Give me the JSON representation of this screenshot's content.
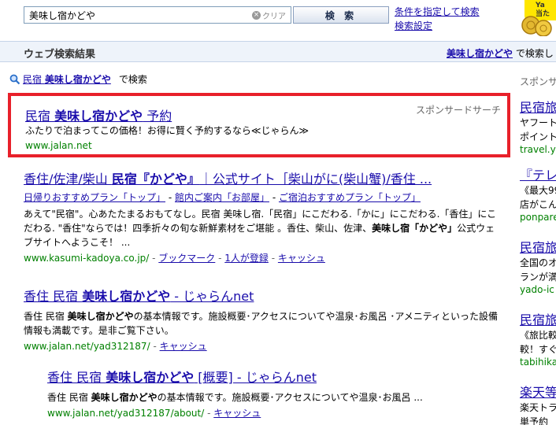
{
  "search": {
    "query": "美味し宿かどや",
    "clear_label": "クリア",
    "clear_x": "×",
    "button_label": "検 索",
    "condition_link": "条件を指定して検索",
    "settings_link": "検索設定"
  },
  "promo": {
    "line1": "Ya",
    "line2": "当た"
  },
  "results_header": {
    "title": "ウェブ検索結果",
    "query_link": "美味し宿かどや",
    "query_suffix": "で検索し"
  },
  "also_search": {
    "prefix": "民宿",
    "query": "美味し宿かどや",
    "suffix": "で検索"
  },
  "sponsored": {
    "label": "スポンサードサーチ",
    "title_prefix": "民宿 ",
    "title_bold": "美味し宿かどや",
    "title_suffix": " 予約",
    "description": "ふたりで泊まってこの価格！お得に賢く予約するなら≪じゃらん≫",
    "url": "www.jalan.net"
  },
  "results": [
    {
      "title_a": "香住/佐津/柴山 ",
      "title_b": "民宿『かどや』",
      "title_c": "｜公式サイト［柴山がに(柴山蟹)/香住 ...",
      "sublinks": [
        "日帰りおすすめプラン「トップ」",
        "館内ご案内「お部屋」",
        "ご宿泊おすすめプラン「トップ」"
      ],
      "sublink_sep": " - ",
      "snippet_1": "あえて\"民宿\"。心あたたまるおもてなし。民宿 美味し宿.「民宿」にこだわる.「かに」にこだわる.「香住」にこだわる. \"香住\"ならでは！四季折々の旬な新鮮素材をご堪能 。香住、柴山、佐津、",
      "snippet_bold": "美味し宿「かどや」",
      "snippet_2": "公式ウェブサイトへようこそ！ ...",
      "url": "www.kasumi-kadoya.co.jp/",
      "bookmark": "ブックマーク",
      "registered": "1人が登録",
      "cache": "キャッシュ"
    },
    {
      "title_a": "香住 民宿 ",
      "title_b": "美味し宿かどや",
      "title_c": " - じゃらんnet",
      "snippet_a": "香住 民宿 ",
      "snippet_bold": "美味し宿かどや",
      "snippet_b": "の基本情報です。施設概要･アクセスについてや温泉･お風呂 ･アメニティといった設備情報も満載です。是非ご覧下さい。",
      "url": "www.jalan.net/yad312187/",
      "cache": "キャッシュ"
    },
    {
      "title_a": "香住 民宿 ",
      "title_b": "美味し宿かどや",
      "title_c": " [概要] - じゃらんnet",
      "snippet_a": "香住 民宿 ",
      "snippet_bold": "美味し宿かどや",
      "snippet_b": "の基本情報です。施設概要･アクセスについてや温泉･お風呂 ...",
      "url": "www.jalan.net/yad312187/about/",
      "cache": "キャッシュ"
    }
  ],
  "right_column": {
    "label": "スポンサ",
    "items": [
      {
        "title": "民宿旅",
        "l1": "ヤフートラ",
        "l2": "ポイントや",
        "url": "travel.ya"
      },
      {
        "title": "『テレビ",
        "l1": "《最大99",
        "l2": "店がこん",
        "url": "ponpare"
      },
      {
        "title": "民宿旅",
        "l1": "全国のオ",
        "l2": "ランが満",
        "url": "yado-ic"
      },
      {
        "title": "民宿旅",
        "l1": "《旅比較",
        "l2": "較！すぐ",
        "url": "tabihika"
      },
      {
        "title": "楽天等",
        "l1": "楽天トラ",
        "l2": "単予約"
      }
    ]
  },
  "colors": {
    "link": "#1a0dab",
    "url_green": "#008000",
    "sponsor_border": "#e8202a",
    "header_bg": "#eef3fa"
  }
}
